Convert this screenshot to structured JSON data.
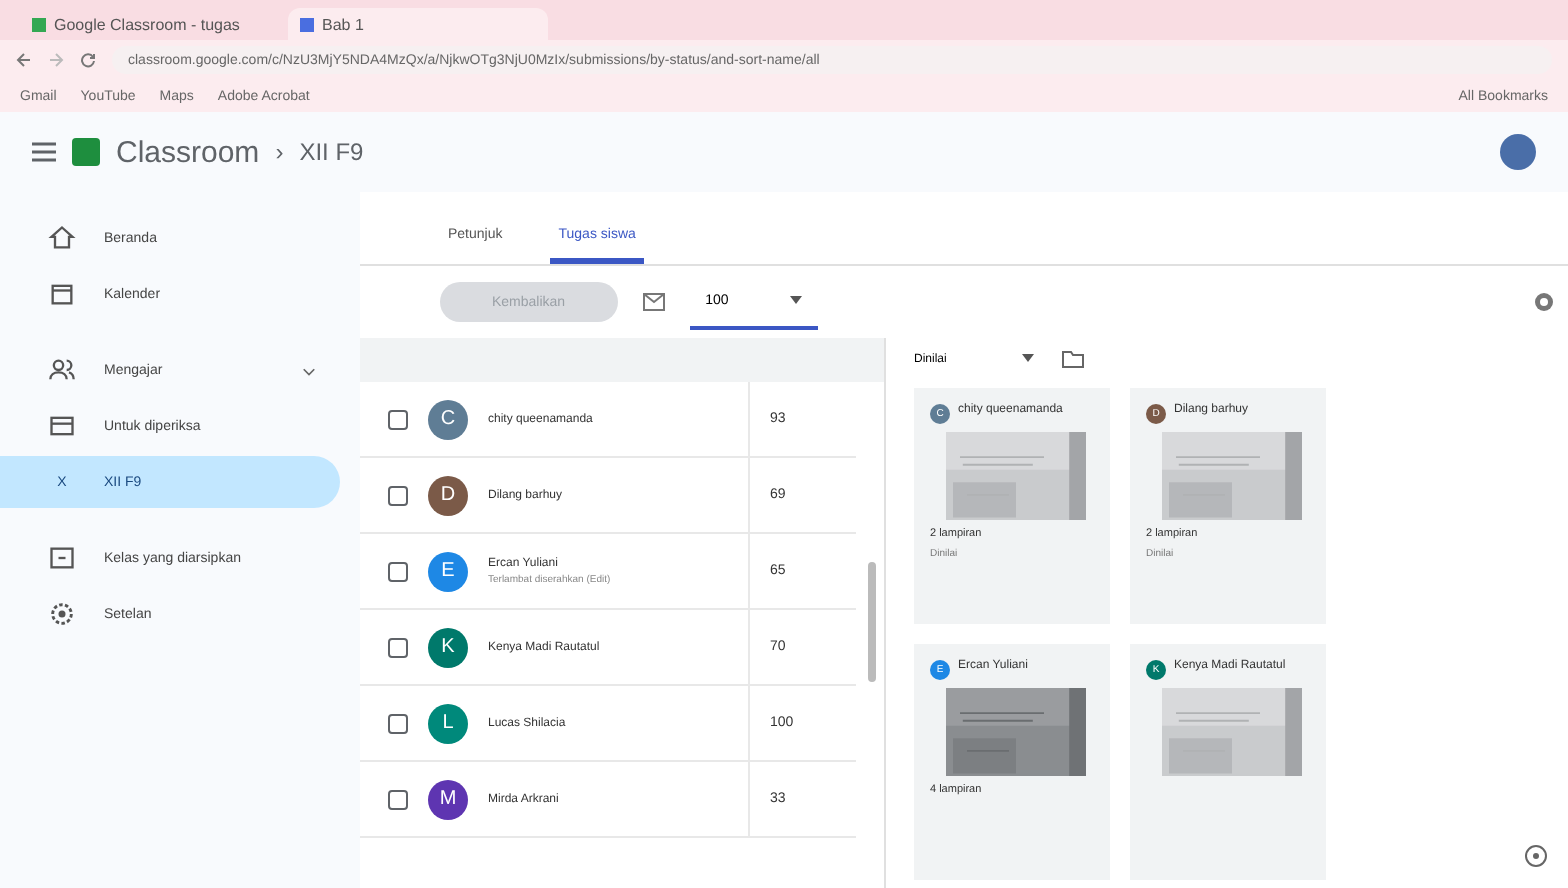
{
  "browser": {
    "tabs": [
      {
        "title": "Google Classroom - tugas",
        "selected": false
      },
      {
        "title": "Bab 1",
        "selected": true
      }
    ],
    "url": "classroom.google.com/c/NzU3MjY5NDA4MzQx/a/NjkwOTg3NjU0MzIx/submissions/by-status/and-sort-name/all",
    "bookmarks": [
      "Gmail",
      "YouTube",
      "Maps",
      "Adobe Acrobat"
    ],
    "all_bookmarks": "All Bookmarks"
  },
  "header": {
    "app": "Classroom",
    "separator": "›",
    "class": "XII F9"
  },
  "sidebar": {
    "items": [
      {
        "label": "Beranda",
        "selected": false
      },
      {
        "label": "Kalender",
        "selected": false
      },
      {
        "label": "Mengajar",
        "selected": false,
        "expanded": true
      },
      {
        "label": "Untuk diperiksa",
        "selected": false
      },
      {
        "label": "XII F9",
        "initial": "X",
        "selected": true
      },
      {
        "label": "Kelas yang diarsipkan",
        "selected": false
      },
      {
        "label": "Setelan",
        "selected": false
      }
    ]
  },
  "tabs": [
    {
      "label": "Petunjuk",
      "selected": false
    },
    {
      "label": "Tugas siswa",
      "selected": true
    }
  ],
  "toolbar": {
    "return_button": "Kembalikan",
    "return_disabled": true,
    "points": "100"
  },
  "students": [
    {
      "initial": "C",
      "name": "chity queenamanda",
      "grade": "93",
      "color": "#5f7d95",
      "checked": false
    },
    {
      "initial": "D",
      "name": "Dilang barhuy",
      "grade": "69",
      "color": "#7b5a48",
      "checked": false
    },
    {
      "initial": "E",
      "name": "Ercan Yuliani",
      "note": "Terlambat diserahkan (Edit)",
      "grade": "65",
      "color": "#1e88e5",
      "checked": false
    },
    {
      "initial": "K",
      "name": "Kenya Madi Rautatul",
      "grade": "70",
      "color": "#00796b",
      "checked": false
    },
    {
      "initial": "L",
      "name": "Lucas Shilacia",
      "grade": "100",
      "color": "#00897b",
      "checked": false
    },
    {
      "initial": "M",
      "name": "Mirda Arkrani",
      "grade": "33",
      "color": "#5e35b1",
      "checked": false
    }
  ],
  "filter": {
    "value": "Dinilai"
  },
  "cards": [
    {
      "initial": "C",
      "name": "chity queenamanda",
      "color": "#5f7d95",
      "attachments": "2 lampiran",
      "status": "Dinilai"
    },
    {
      "initial": "D",
      "name": "Dilang barhuy",
      "color": "#7b5a48",
      "attachments": "2 lampiran",
      "status": "Dinilai"
    },
    {
      "initial": "E",
      "name": "Ercan Yuliani",
      "color": "#1e88e5",
      "attachments": "4 lampiran"
    },
    {
      "initial": "K",
      "name": "Kenya Madi Rautatul",
      "color": "#00796b"
    }
  ]
}
